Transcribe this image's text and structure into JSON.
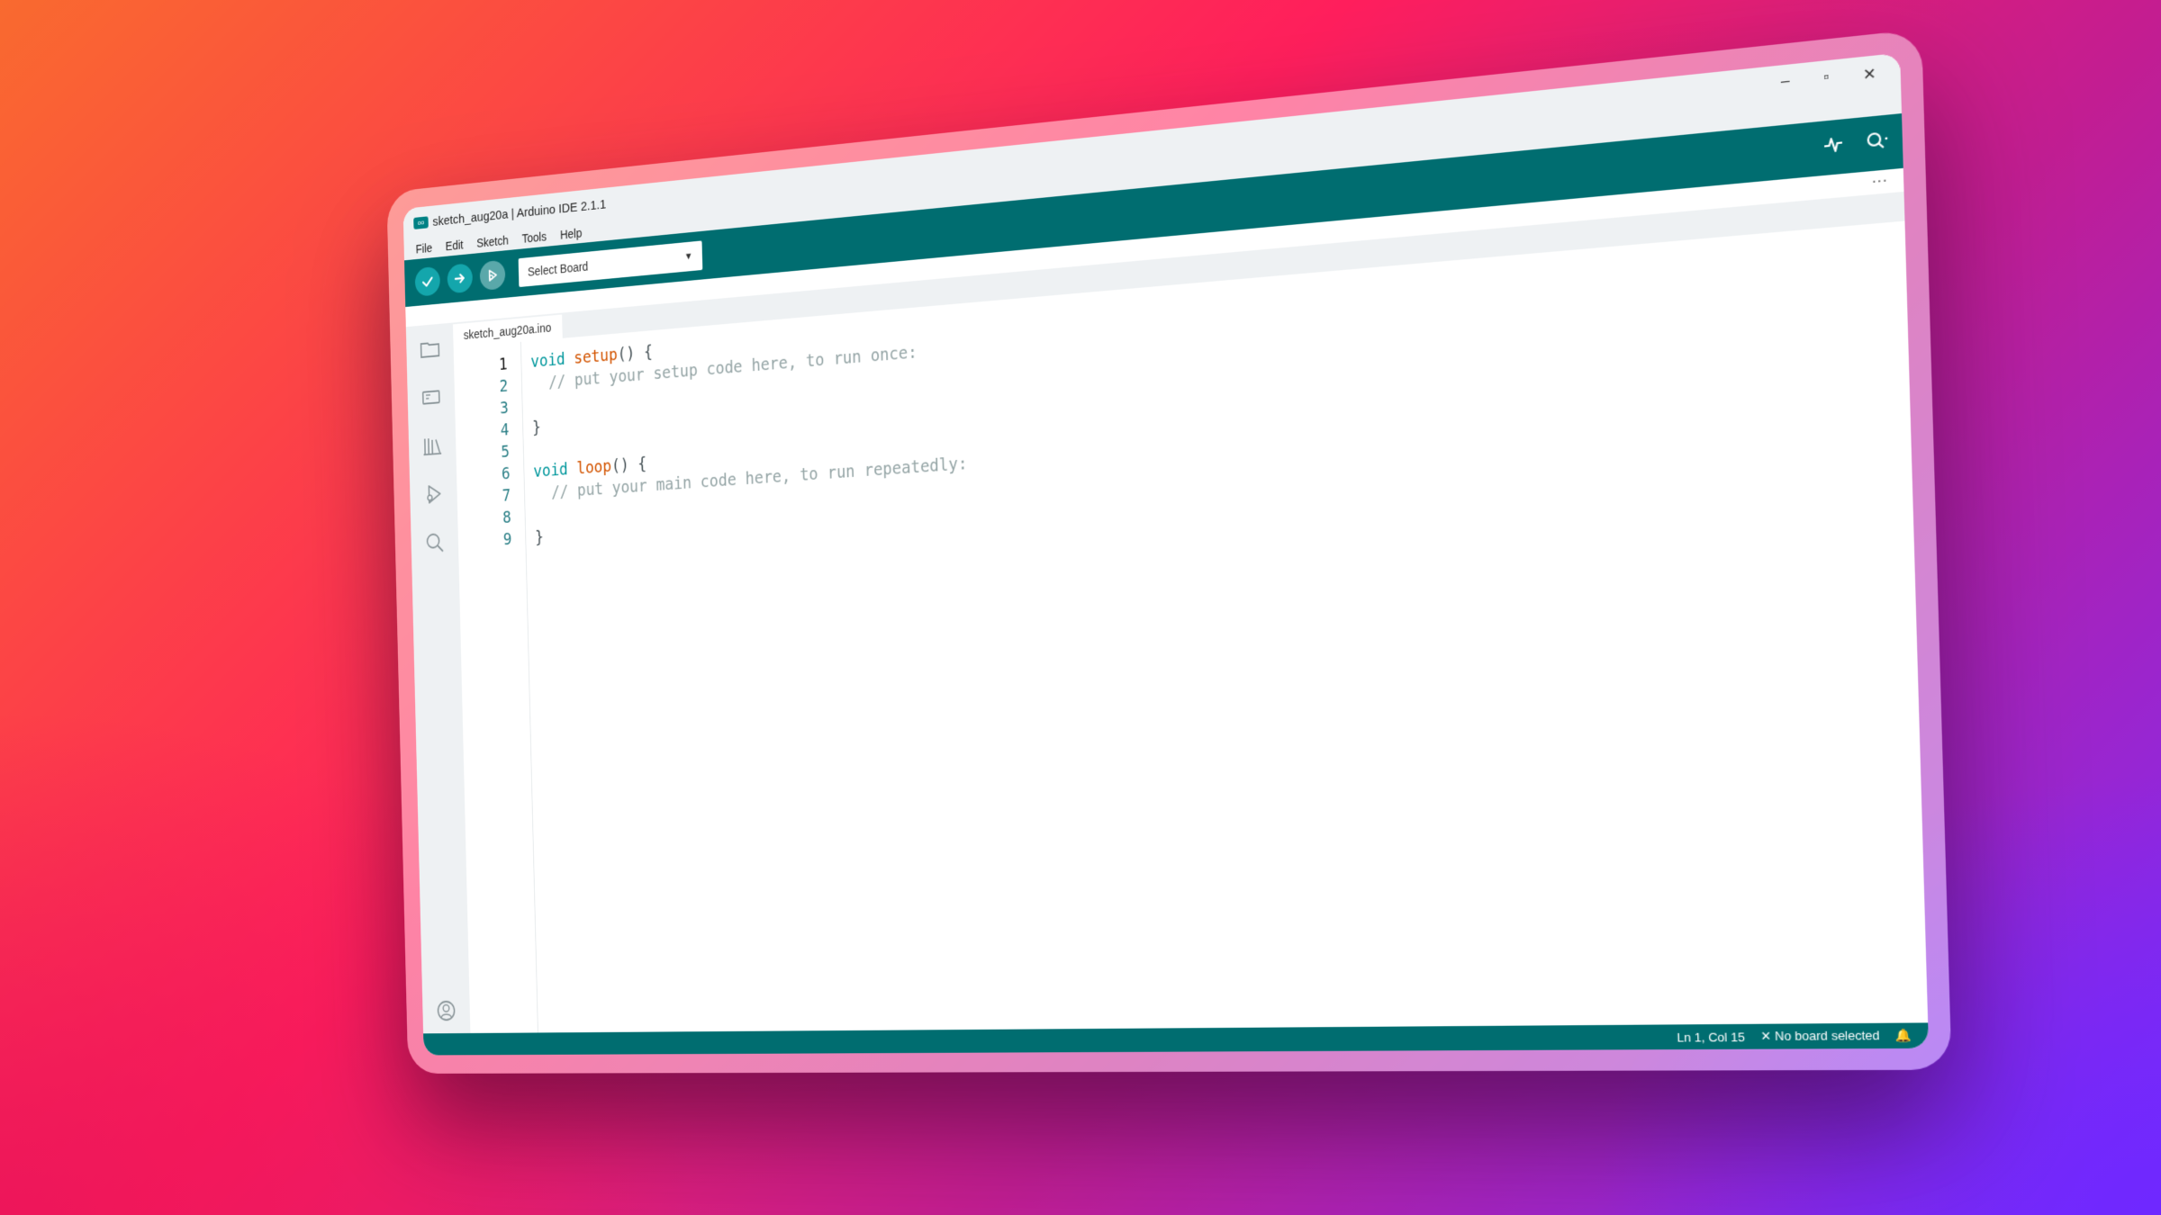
{
  "window": {
    "title": "sketch_aug20a | Arduino IDE 2.1.1",
    "app_icon_text": "oo",
    "controls": {
      "minimize": "–",
      "maximize": "▫",
      "close": "✕"
    }
  },
  "menu": [
    "File",
    "Edit",
    "Sketch",
    "Tools",
    "Help"
  ],
  "toolbar": {
    "board_select": "Select Board",
    "more": "···"
  },
  "tabs": [
    "sketch_aug20a.ino"
  ],
  "editor": {
    "line_numbers": [
      "1",
      "2",
      "3",
      "4",
      "5",
      "6",
      "7",
      "8",
      "9"
    ],
    "lines": [
      {
        "kw": "void",
        "fn": "setup",
        "rest": "() {"
      },
      {
        "comment": "  // put your setup code here, to run once:"
      },
      {
        "text": ""
      },
      {
        "text": "}"
      },
      {
        "text": ""
      },
      {
        "kw": "void",
        "fn": "loop",
        "rest": "() {"
      },
      {
        "comment": "  // put your main code here, to run repeatedly:"
      },
      {
        "text": ""
      },
      {
        "text": "}"
      }
    ]
  },
  "status": {
    "cursor": "Ln 1, Col 15",
    "board": "✕ No board selected",
    "bell": "🔔"
  },
  "colors": {
    "toolbar": "#006d70",
    "button": "#14a6ac",
    "keyword": "#00979c",
    "function": "#d35400",
    "comment": "#95a5a6"
  }
}
